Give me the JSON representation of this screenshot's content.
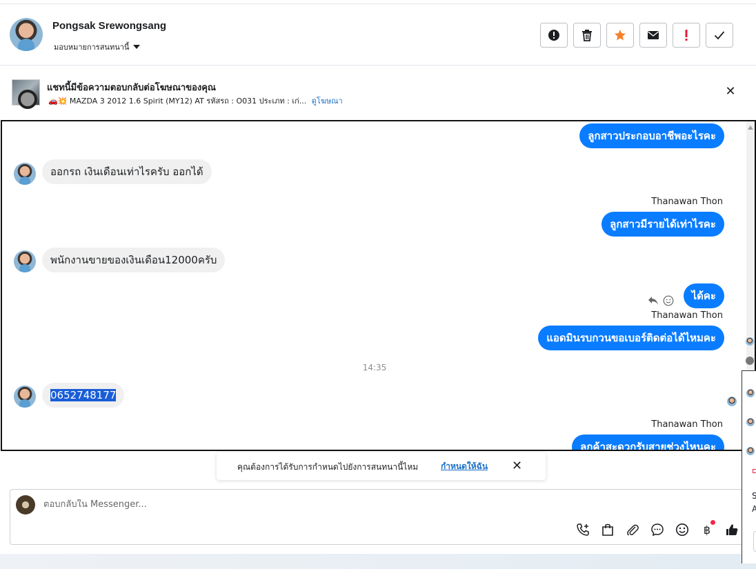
{
  "header": {
    "contact_name": "Pongsak Srewongsang",
    "assign_label": "มอบหมายการสนทนานี้",
    "actions": [
      {
        "name": "mark-spam",
        "icon": "alert-circle-icon"
      },
      {
        "name": "delete",
        "icon": "trash-icon"
      },
      {
        "name": "star",
        "icon": "star-icon",
        "color": "#f5802b"
      },
      {
        "name": "mark-unread",
        "icon": "envelope-icon"
      },
      {
        "name": "follow-up",
        "icon": "exclamation-icon",
        "color": "#e41e3f"
      },
      {
        "name": "mark-done",
        "icon": "check-icon"
      }
    ]
  },
  "ad": {
    "title": "แชทนี้มีข้อความตอบกลับต่อโฆษณาของคุณ",
    "subtitle": "🚗💥 MAZDA 3 2012 1.6 Spirit (MY12) AT รหัสรถ : O031 ประเภท : เก่...",
    "link": "ดูโฆษณา"
  },
  "messages": {
    "m1": "ลูกสาวประกอบอาชีพอะไรคะ",
    "m2": "ออกรถ เงินเดือนเท่าไรครับ ออกได้",
    "m3_sender": "Thanawan Thon",
    "m3": "ลูกสาวมีรายได้เท่าไรคะ",
    "m4": "พนักงานขายของเงินเดือน12000ครับ",
    "m5": "ได้คะ",
    "m6_sender": "Thanawan Thon",
    "m6": "แอดมินรบกวนขอเบอร์ติดต่อได้ไหมคะ",
    "timestamp": "14:35",
    "m7": "0652748177",
    "m8_sender": "Thanawan Thon",
    "m8": "ลูกค้าสะดวกรับสายช่วงไหนคะ"
  },
  "toast": {
    "text": "คุณต้องการได้รับการกำหนดไปยังการสนทนานี้ไหม",
    "link": "กำหนดให้ฉัน"
  },
  "composer": {
    "placeholder": "ตอบกลับใน Messenger...",
    "tools": [
      "call-add-icon",
      "shopping-bag-icon",
      "paperclip-icon",
      "chat-bubble-icon",
      "emoji-icon",
      "baht-icon",
      "thumbs-up-icon"
    ]
  },
  "side_panel": {
    "line1": "S",
    "line2": "A"
  }
}
